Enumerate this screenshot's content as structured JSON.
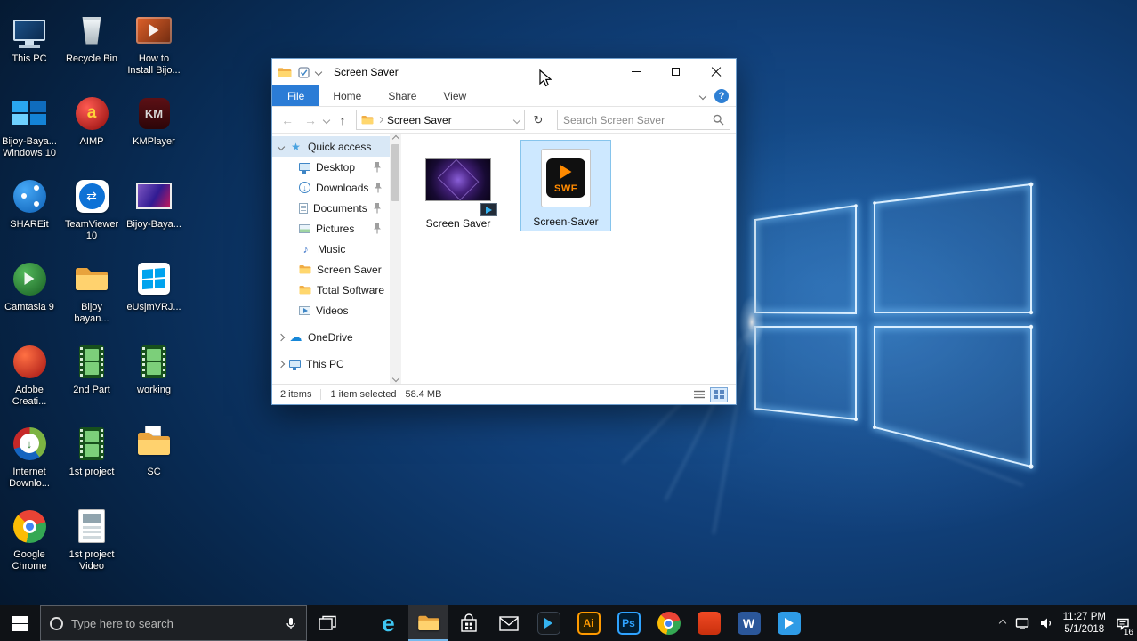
{
  "icon_glyphs": {
    "help": "?",
    "edge": "e",
    "illustrator": "Ai",
    "photoshop": "Ps",
    "word": "W",
    "aimp": "a",
    "kmplayer": "KM",
    "teamviewer": "⇄",
    "idm_arrow": "↓",
    "swf": "SWF",
    "music_note": "♪",
    "cloud": "☁",
    "star": "★"
  },
  "desktop": {
    "icons": [
      {
        "label": "This PC"
      },
      {
        "label": "Recycle Bin"
      },
      {
        "label": "How to Install Bijo..."
      },
      {
        "label": "Bijoy-Baya... Windows 10"
      },
      {
        "label": "AIMP"
      },
      {
        "label": "KMPlayer"
      },
      {
        "label": "SHAREit"
      },
      {
        "label": "TeamViewer 10"
      },
      {
        "label": "Bijoy-Baya..."
      },
      {
        "label": "Camtasia 9"
      },
      {
        "label": "Bijoy bayan..."
      },
      {
        "label": "eUsjmVRJ..."
      },
      {
        "label": "Adobe Creati..."
      },
      {
        "label": "2nd Part"
      },
      {
        "label": "working"
      },
      {
        "label": "Internet Downlo..."
      },
      {
        "label": "1st project"
      },
      {
        "label": "SC"
      },
      {
        "label": "Google Chrome"
      },
      {
        "label": "1st project Video"
      }
    ]
  },
  "explorer": {
    "title": "Screen Saver",
    "ribbon": {
      "tabs": [
        "File",
        "Home",
        "Share",
        "View"
      ],
      "help": "?"
    },
    "nav": {
      "address": "Screen Saver",
      "search_placeholder": "Search Screen Saver"
    },
    "sidebar": {
      "items": [
        {
          "label": "Quick access"
        },
        {
          "label": "Desktop"
        },
        {
          "label": "Downloads"
        },
        {
          "label": "Documents"
        },
        {
          "label": "Pictures"
        },
        {
          "label": "Music"
        },
        {
          "label": "Screen Saver"
        },
        {
          "label": "Total Software"
        },
        {
          "label": "Videos"
        },
        {
          "label": "OneDrive"
        },
        {
          "label": "This PC"
        }
      ]
    },
    "files": [
      {
        "name": "Screen Saver"
      },
      {
        "name": "Screen-Saver"
      }
    ],
    "status": {
      "items": "2 items",
      "selected": "1 item selected",
      "size": "58.4 MB"
    }
  },
  "taskbar": {
    "search_placeholder": "Type here to search"
  },
  "tray": {
    "time": "11:27 PM",
    "date": "5/1/2018",
    "badge": "16"
  }
}
